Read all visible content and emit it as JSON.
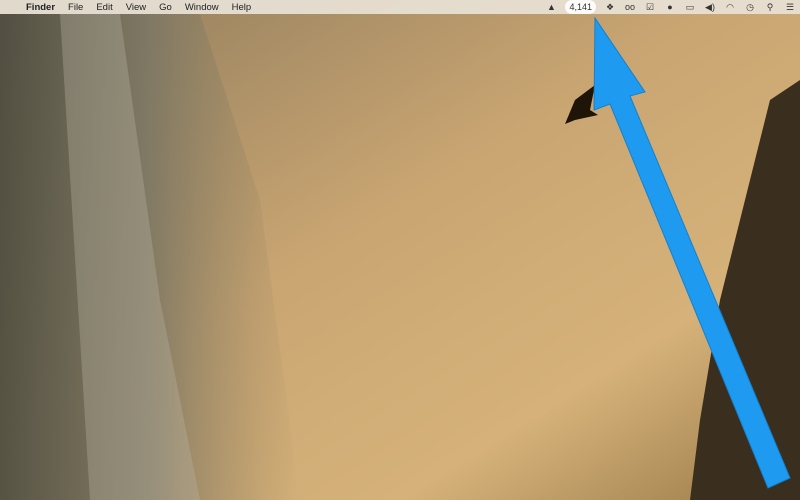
{
  "menubar": {
    "app_name": "Finder",
    "menus": [
      "File",
      "Edit",
      "View",
      "Go",
      "Window",
      "Help"
    ],
    "status_count": "4,141",
    "status_icons": [
      "google-drive-icon",
      "dropbox-icon",
      "glasses-icon",
      "checkmark-icon",
      "evernote-icon",
      "battery-icon",
      "volume-icon",
      "wifi-icon",
      "clock-icon",
      "spotlight-search-icon",
      "notification-center-icon"
    ]
  },
  "colors": {
    "arrow": "#1e9bf0",
    "menubar": "#e8e2d6"
  }
}
